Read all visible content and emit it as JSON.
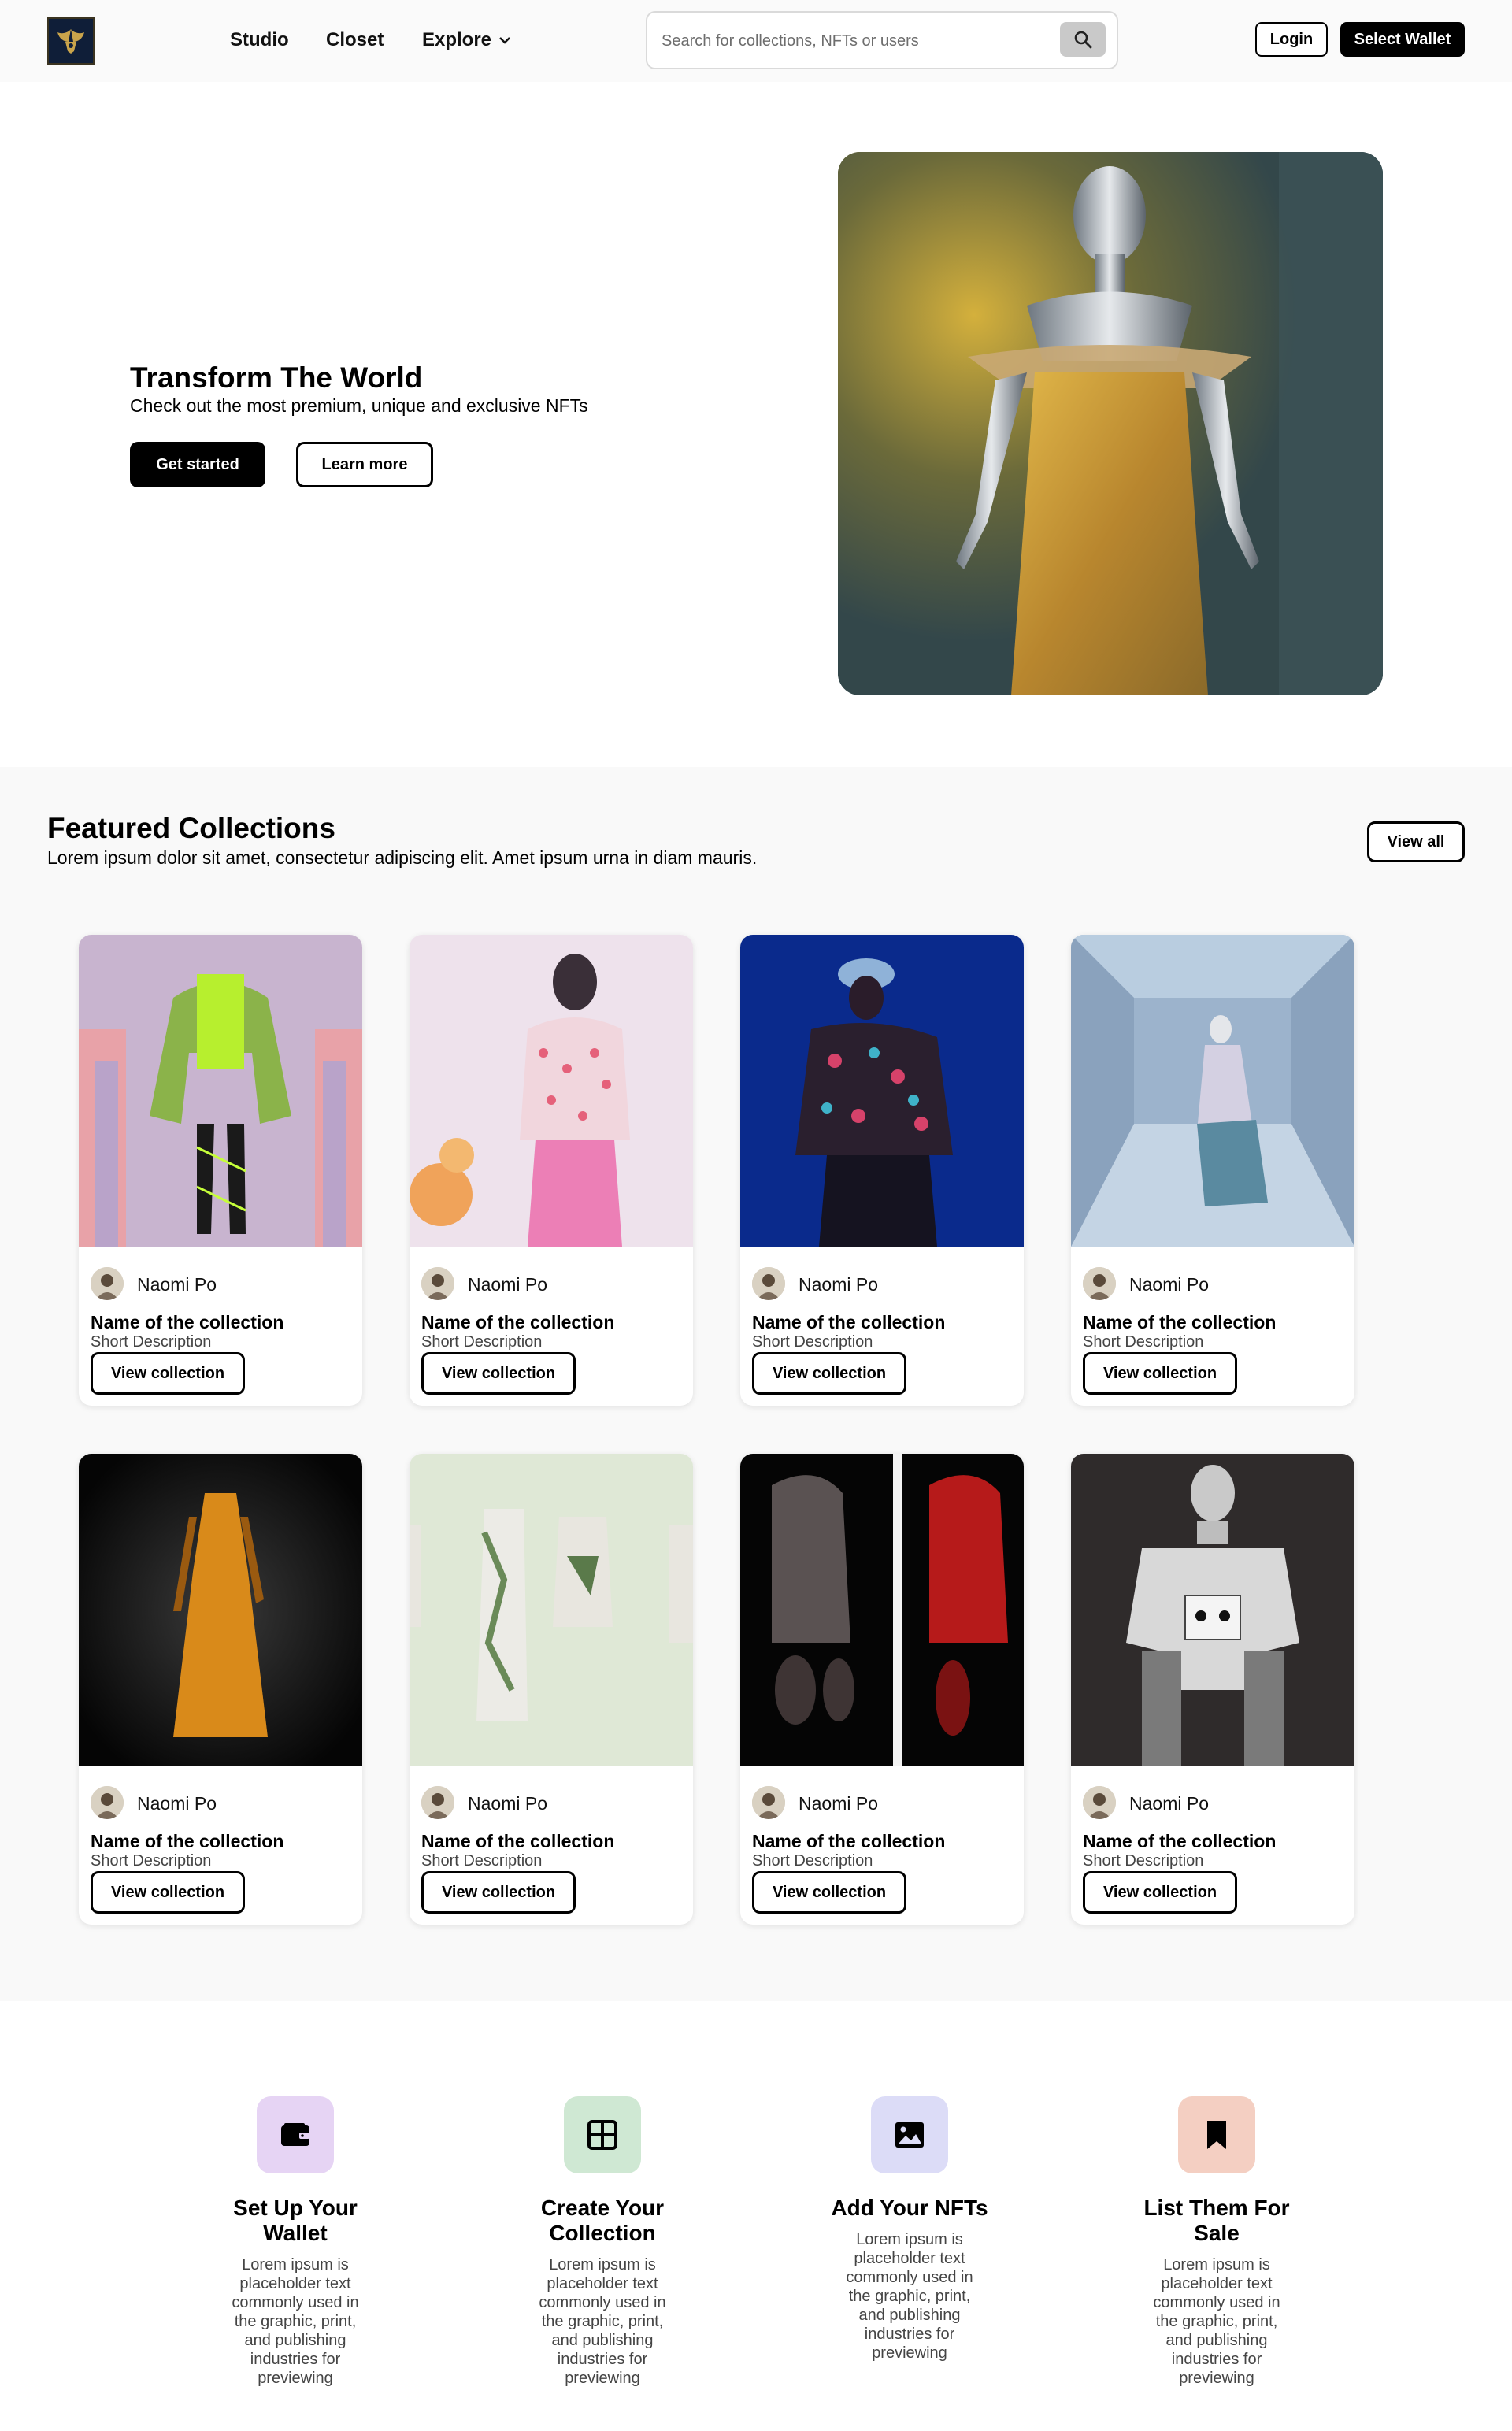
{
  "nav": {
    "logo_icon": "winged-crest-logo",
    "links": [
      "Studio",
      "Closet",
      "Explore"
    ],
    "explore_icon": "chevron-down-icon",
    "search_placeholder": "Search for collections, NFTs or users",
    "search_icon": "search-icon",
    "login_label": "Login",
    "wallet_label": "Select Wallet"
  },
  "hero": {
    "title": "Transform The World",
    "subtitle": "Check out the most premium, unique and exclusive NFTs",
    "primary_label": "Get started",
    "secondary_label": "Learn more"
  },
  "featured": {
    "title": "Featured Collections",
    "subtitle": "Lorem ipsum dolor sit amet, consectetur adipiscing elit. Amet ipsum urna in diam mauris.",
    "view_all_label": "View all",
    "cards": [
      {
        "creator": "Naomi Po",
        "name": "Name of the collection",
        "desc": "Short Description",
        "button": "View collection"
      },
      {
        "creator": "Naomi Po",
        "name": "Name of the collection",
        "desc": "Short Description",
        "button": "View collection"
      },
      {
        "creator": "Naomi Po",
        "name": "Name of the collection",
        "desc": "Short Description",
        "button": "View collection"
      },
      {
        "creator": "Naomi Po",
        "name": "Name of the collection",
        "desc": "Short Description",
        "button": "View collection"
      },
      {
        "creator": "Naomi Po",
        "name": "Name of the collection",
        "desc": "Short Description",
        "button": "View collection"
      },
      {
        "creator": "Naomi Po",
        "name": "Name of the collection",
        "desc": "Short Description",
        "button": "View collection"
      },
      {
        "creator": "Naomi Po",
        "name": "Name of the collection",
        "desc": "Short Description",
        "button": "View collection"
      },
      {
        "creator": "Naomi Po",
        "name": "Name of the collection",
        "desc": "Short Description",
        "button": "View collection"
      }
    ]
  },
  "steps": [
    {
      "icon": "wallet-icon",
      "color": "#e6d4f4",
      "title": "Set Up Your Wallet",
      "text": "Lorem ipsum is placeholder text commonly used in the graphic, print, and publishing industries for previewing"
    },
    {
      "icon": "grid-icon",
      "color": "#cfe8d3",
      "title": "Create Your Collection",
      "text": "Lorem ipsum is placeholder text commonly used in the graphic, print, and publishing industries for previewing"
    },
    {
      "icon": "image-icon",
      "color": "#dcdcf7",
      "title": "Add Your NFTs",
      "text": "Lorem ipsum is placeholder text commonly used in the graphic, print, and publishing industries for previewing"
    },
    {
      "icon": "bookmark-icon",
      "color": "#f4cfc2",
      "title": "List Them For Sale",
      "text": "Lorem ipsum is placeholder text commonly used in the graphic, print, and publishing industries for previewing"
    }
  ]
}
